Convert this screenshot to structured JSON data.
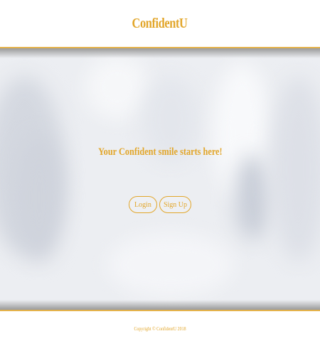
{
  "header": {
    "brand": "ConfidentU"
  },
  "hero": {
    "tagline": "Your Confident smile starts here!",
    "login_label": "Login",
    "signup_label": "Sign Up"
  },
  "footer": {
    "copyright": "Copyright © ConfidentU 2018"
  },
  "colors": {
    "accent": "#e2a62a",
    "background": "#ffffff",
    "hero_background": "#eceef2"
  }
}
